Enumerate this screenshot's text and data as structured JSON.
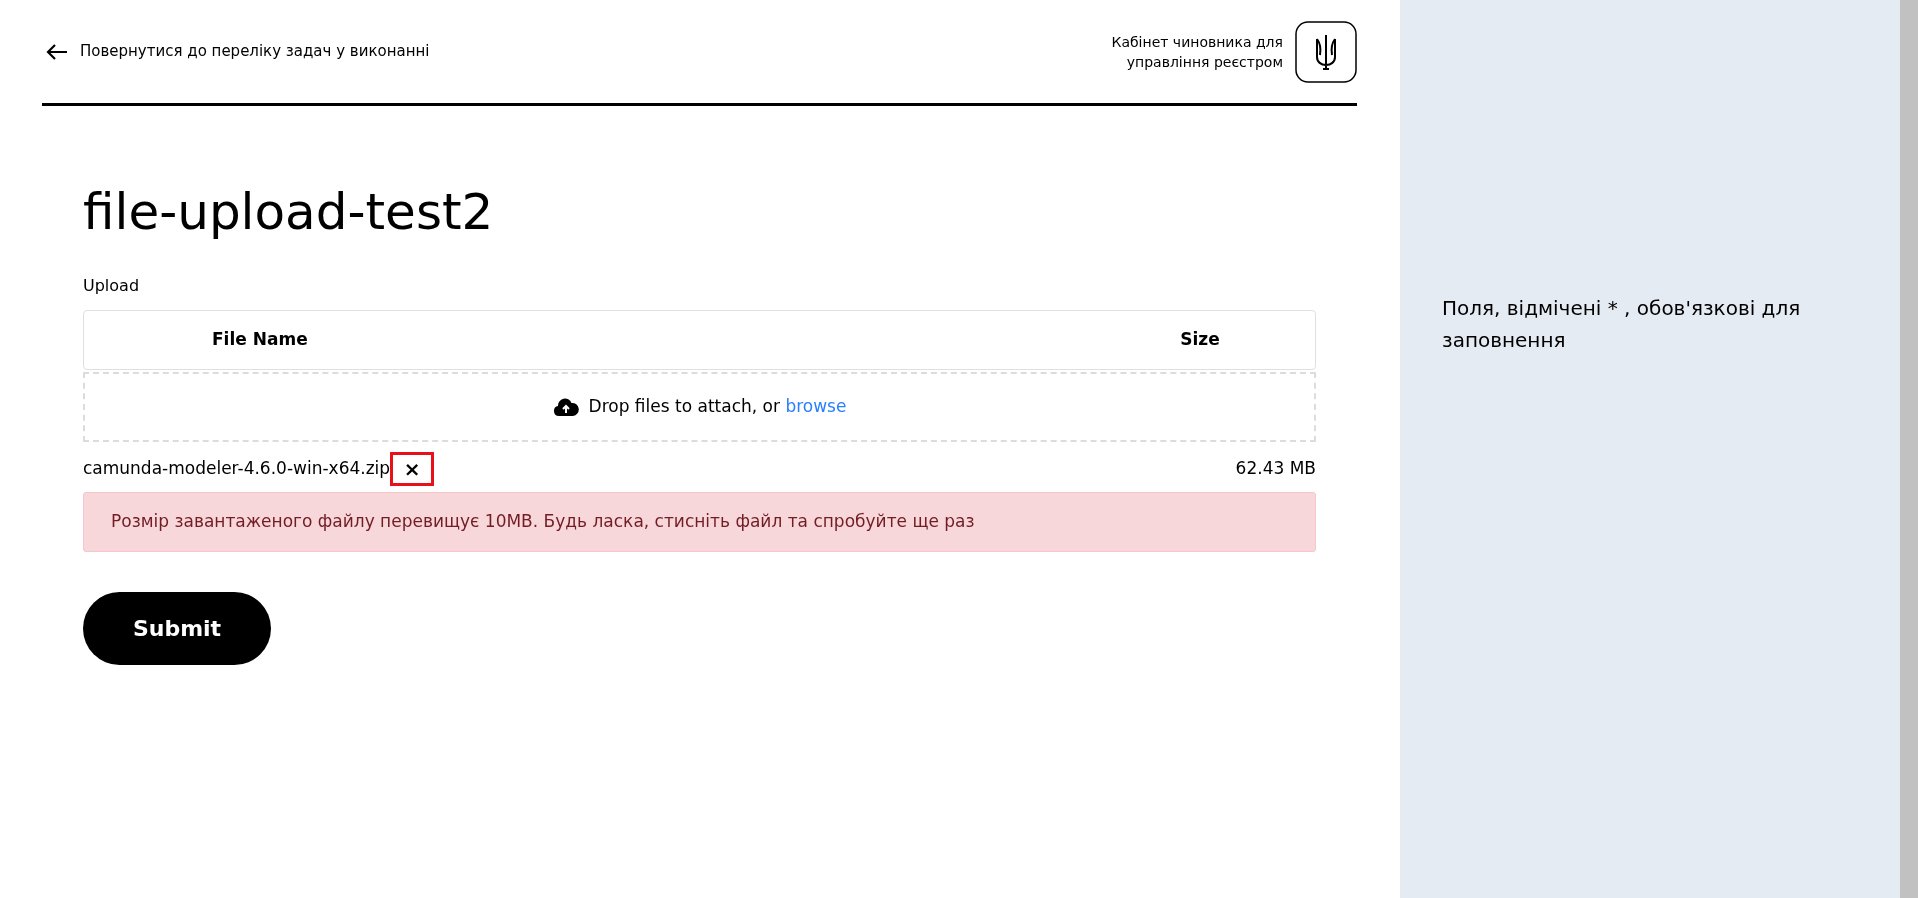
{
  "header": {
    "back_link": "Повернутися до переліку задач у виконанні",
    "cabinet_title": [
      "Кабінет чиновника для",
      "управління реєстром"
    ]
  },
  "page_title": "file-upload-test2",
  "upload": {
    "label": "Upload",
    "columns": [
      "File Name",
      "Size"
    ],
    "dropzone": {
      "text": "Drop files to attach, or",
      "link": "browse"
    },
    "files": [
      {
        "name": "camunda-modeler-4.6.0-win-x64.zip",
        "remove": "×",
        "size": "62.43 MB",
        "highlighted": true
      }
    ],
    "error": "Розмір завантаженого файлу перевищує 10MB. Будь ласка, стисніть файл та спробуйте ще раз"
  },
  "submit": "Submit",
  "side_note": "Поля, відмічені * , обов'язкові для заповнення"
}
